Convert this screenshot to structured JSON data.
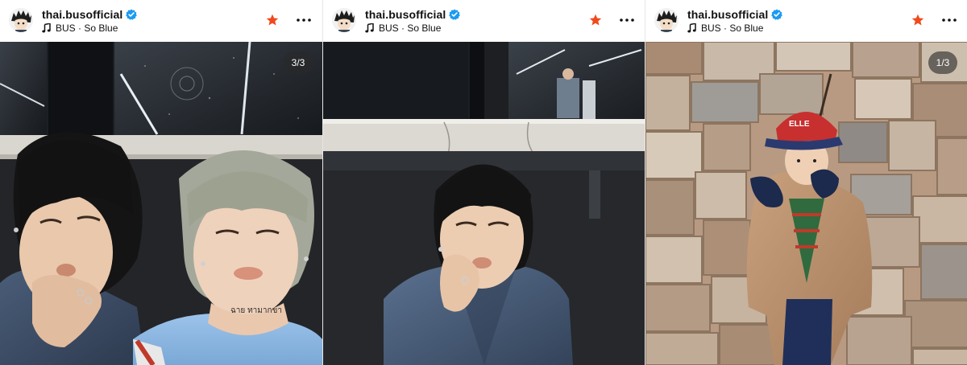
{
  "panels": [
    {
      "username": "thai.busofficial",
      "music": "BUS · So Blue",
      "counter": "3/3",
      "tattoo_text": "ฉาย ทามากขา"
    },
    {
      "username": "thai.busofficial",
      "music": "BUS · So Blue"
    },
    {
      "username": "thai.busofficial",
      "music": "BUS · So Blue",
      "counter": "1/3",
      "cap_text": "ELLE"
    }
  ],
  "colors": {
    "verified": "#1d9bf0",
    "favorite_star": "#f04a1c",
    "background": "#ffffff"
  },
  "icons": [
    "avatar",
    "verified-badge-icon",
    "music-note-icon",
    "favorite-star-icon",
    "more-options-icon"
  ]
}
